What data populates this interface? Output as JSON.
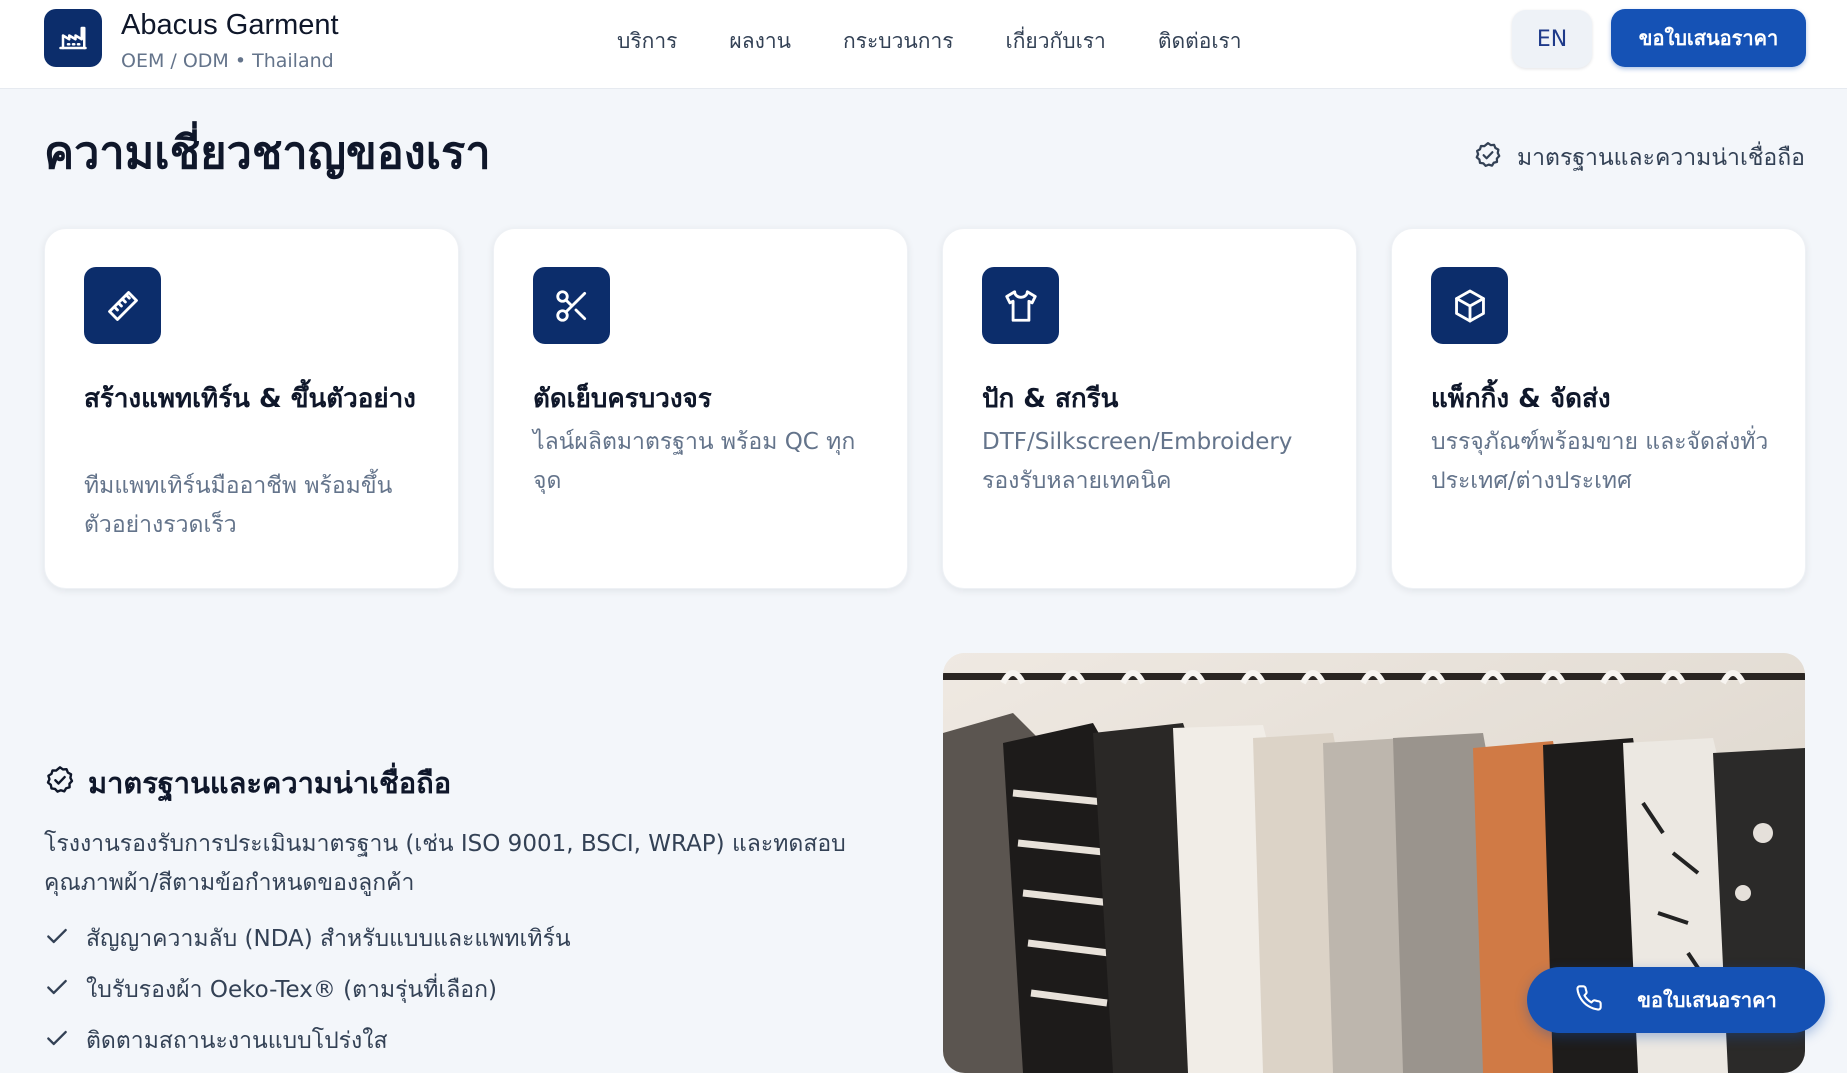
{
  "header": {
    "brand_name": "Abacus Garment",
    "brand_sub": "OEM / ODM • Thailand",
    "nav": [
      "บริการ",
      "ผลงาน",
      "กระบวนการ",
      "เกี่ยวกับเรา",
      "ติดต่อเรา"
    ],
    "lang": "EN",
    "quote_button": "ขอใบเสนอราคา"
  },
  "expertise": {
    "title": "ความเชี่ยวชาญของเรา",
    "badge": "มาตรฐานและความน่าเชื่อถือ",
    "cards": [
      {
        "icon": "ruler-icon",
        "title": "สร้างแพทเทิร์น & ขึ้นตัวอย่าง",
        "desc": "ทีมแพทเทิร์นมืออาชีพ พร้อมขึ้นตัวอย่างรวดเร็ว"
      },
      {
        "icon": "scissors-icon",
        "title": "ตัดเย็บครบวงจร",
        "desc": "ไลน์ผลิตมาตรฐาน พร้อม QC ทุกจุด"
      },
      {
        "icon": "shirt-icon",
        "title": "ปัก & สกรีน",
        "desc": "DTF/Silkscreen/Embroidery รองรับหลายเทคนิค"
      },
      {
        "icon": "package-icon",
        "title": "แพ็กกิ้ง & จัดส่ง",
        "desc": "บรรจุภัณฑ์พร้อมขาย และจัดส่งทั่วประเทศ/ต่างประเทศ"
      }
    ]
  },
  "standards": {
    "heading": "มาตรฐานและความน่าเชื่อถือ",
    "desc": "โรงงานรองรับการประเมินมาตรฐาน (เช่น ISO 9001, BSCI, WRAP) และทดสอบคุณภาพผ้า/สีตามข้อกำหนดของลูกค้า",
    "items": [
      "สัญญาความลับ (NDA) สำหรับแบบและแพทเทิร์น",
      "ใบรับรองผ้า Oeko-Tex® (ตามรุ่นที่เลือก)",
      "ติดตามสถานะงานแบบโปร่งใส"
    ]
  },
  "floating_cta": {
    "label": "ขอใบเสนอราคา",
    "icon": "phone-icon"
  },
  "colors": {
    "primary": "#1552b5",
    "navy": "#0c2d6b",
    "background": "#f3f6fa"
  }
}
